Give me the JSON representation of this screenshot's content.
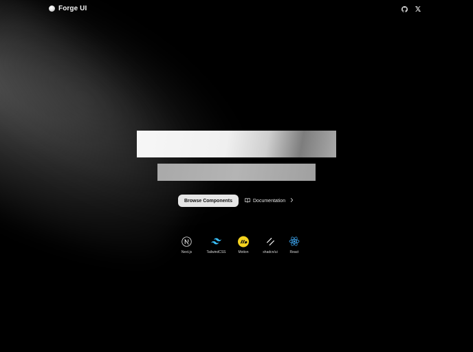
{
  "header": {
    "brand": "Forge UI",
    "icons": [
      {
        "name": "github-icon"
      },
      {
        "name": "x-twitter-icon"
      }
    ]
  },
  "hero": {
    "primary_button": "Browse Components",
    "secondary_button": "Documentation"
  },
  "tech_stack": [
    {
      "label": "Next.js",
      "icon": "nextjs-icon"
    },
    {
      "label": "TailwindCSS",
      "icon": "tailwind-icon"
    },
    {
      "label": "Motion",
      "icon": "motion-icon"
    },
    {
      "label": "shadcn/ui",
      "icon": "shadcn-icon"
    },
    {
      "label": "React",
      "icon": "react-icon"
    }
  ],
  "colors": {
    "background": "#000000",
    "primary_button_bg": "#e6e6e6",
    "motion_yellow": "#f5d31f",
    "tailwind_cyan": "#38bdf8",
    "react_blue": "#3fa9f5"
  }
}
